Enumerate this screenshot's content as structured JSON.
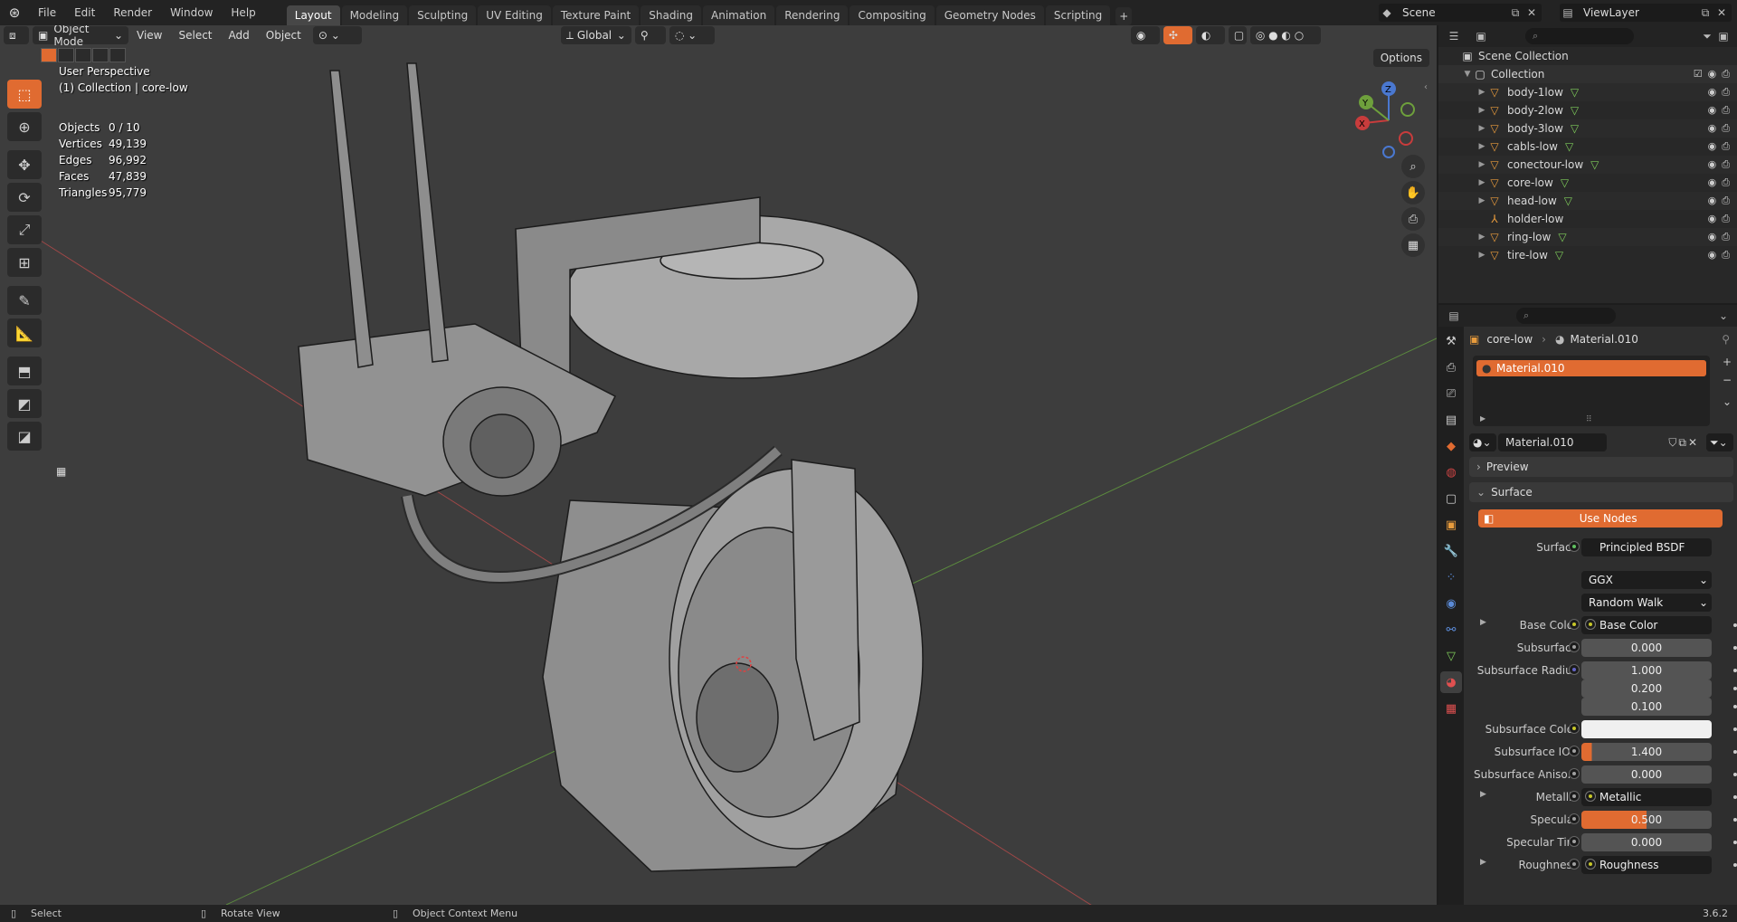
{
  "topbar": {
    "menus": [
      "File",
      "Edit",
      "Render",
      "Window",
      "Help"
    ],
    "workspaces": [
      "Layout",
      "Modeling",
      "Sculpting",
      "UV Editing",
      "Texture Paint",
      "Shading",
      "Animation",
      "Rendering",
      "Compositing",
      "Geometry Nodes",
      "Scripting"
    ],
    "active_workspace": "Layout",
    "add_tab": "+",
    "scene": "Scene",
    "view_layer": "ViewLayer"
  },
  "viewport": {
    "mode": "Object Mode",
    "menus": [
      "View",
      "Select",
      "Add",
      "Object"
    ],
    "transform_orientation": "Global",
    "options_label": "Options",
    "perspective": "User Perspective",
    "collection_info": "(1) Collection | core-low",
    "stats": [
      {
        "label": "Objects",
        "value": "0 / 10"
      },
      {
        "label": "Vertices",
        "value": "49,139"
      },
      {
        "label": "Edges",
        "value": "96,992"
      },
      {
        "label": "Faces",
        "value": "47,839"
      },
      {
        "label": "Triangles",
        "value": "95,779"
      }
    ],
    "gizmo": {
      "x": "X",
      "y": "Y",
      "z": "Z"
    }
  },
  "outliner": {
    "scene_collection": "Scene Collection",
    "collection": "Collection",
    "items": [
      "body-1low",
      "body-2low",
      "body-3low",
      "cabls-low",
      "conectour-low",
      "core-low",
      "head-low",
      "holder-low",
      "ring-low",
      "tire-low"
    ]
  },
  "properties": {
    "object_name": "core-low",
    "material_name": "Material.010",
    "slot_name": "Material.010",
    "datablock_name": "Material.010",
    "preview_label": "Preview",
    "surface_panel": "Surface",
    "use_nodes": "Use Nodes",
    "surface_label": "Surface",
    "surface_value": "Principled BSDF",
    "distribution": "GGX",
    "subsurface_method": "Random Walk",
    "rows": [
      {
        "label": "Base Color",
        "value": "Base Color",
        "kind": "link",
        "socket": "yellow",
        "expand": true
      },
      {
        "label": "Subsurface",
        "value": "0.000",
        "kind": "num"
      },
      {
        "label": "Subsurface Radius",
        "value": "1.000",
        "kind": "num",
        "socket": "purple"
      },
      {
        "label": "",
        "value": "0.200",
        "kind": "num",
        "nosocket": true
      },
      {
        "label": "",
        "value": "0.100",
        "kind": "num",
        "nosocket": true
      },
      {
        "label": "Subsurface Color",
        "value": "",
        "kind": "color",
        "socket": "yellow"
      },
      {
        "label": "Subsurface IOR",
        "value": "1.400",
        "kind": "num"
      },
      {
        "label": "Subsurface Aniso...",
        "value": "0.000",
        "kind": "num"
      },
      {
        "label": "Metallic",
        "value": "Metallic",
        "kind": "link",
        "expand": true
      },
      {
        "label": "Specular",
        "value": "0.500",
        "kind": "slider",
        "fraction": 0.5
      },
      {
        "label": "Specular Tint",
        "value": "0.000",
        "kind": "num"
      },
      {
        "label": "Roughness",
        "value": "Roughness",
        "kind": "link",
        "expand": true
      }
    ]
  },
  "statusbar": {
    "select": "Select",
    "rotate": "Rotate View",
    "context": "Object Context Menu",
    "version": "3.6.2"
  },
  "colors": {
    "accent": "#e06b31",
    "viewport_bg": "#3d3d3d",
    "x_axis": "#c83c3c",
    "y_axis": "#6ea03c"
  }
}
